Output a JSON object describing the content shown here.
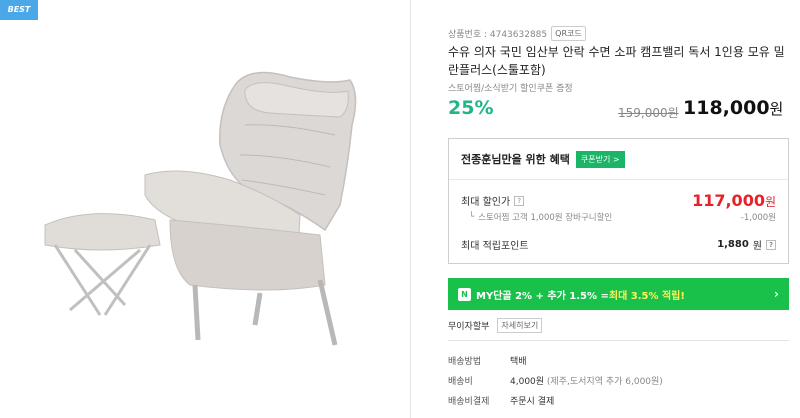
{
  "badge": "BEST",
  "product": {
    "id_label": "상품번호 : 4743632885",
    "qr_label": "QR코드",
    "title": "수유 의자 국민 임산부 안락 수면 소파 캠프밸리 독서 1인용 모유 밀란플러스(스툴포함)",
    "coupon_text": "스토어찜/소식받기 할인쿠폰 증정",
    "discount": "25%",
    "old_price": "159,000원",
    "price": "118,000",
    "price_unit": "원"
  },
  "benefit": {
    "title": "전종훈님만을 위한 혜택",
    "coupon_button": "쿠폰받기 >",
    "max_discount_label": "최대 할인가",
    "max_discount_price": "117,000",
    "max_discount_unit": "원",
    "store_discount_label": "스토어찜 고객 1,000원 장바구니할인",
    "store_discount_value": "-1,000원",
    "points_label": "최대 적립포인트",
    "points_value": "1,880",
    "points_unit": "원",
    "help_mark": "?"
  },
  "mybar": {
    "badge": "N",
    "text_prefix": "MY단골 2% + 추가 1.5% = ",
    "text_highlight": "최대 3.5% 적립!",
    "chevron": "›"
  },
  "install": {
    "label": "무이자할부",
    "detail_button": "자세히보기"
  },
  "shipping": {
    "method_label": "배송방법",
    "method_value": "택배",
    "fee_label": "배송비",
    "fee_value": "4,000원",
    "fee_note": "(제주,도서지역 추가 6,000원)",
    "payment_label": "배송비결제",
    "payment_value": "주문시 결제"
  },
  "colors": {
    "accent_green": "#21b589",
    "price_red": "#e8202a",
    "mybar_green": "#19c04a",
    "badge_blue": "#4aa8e8"
  }
}
